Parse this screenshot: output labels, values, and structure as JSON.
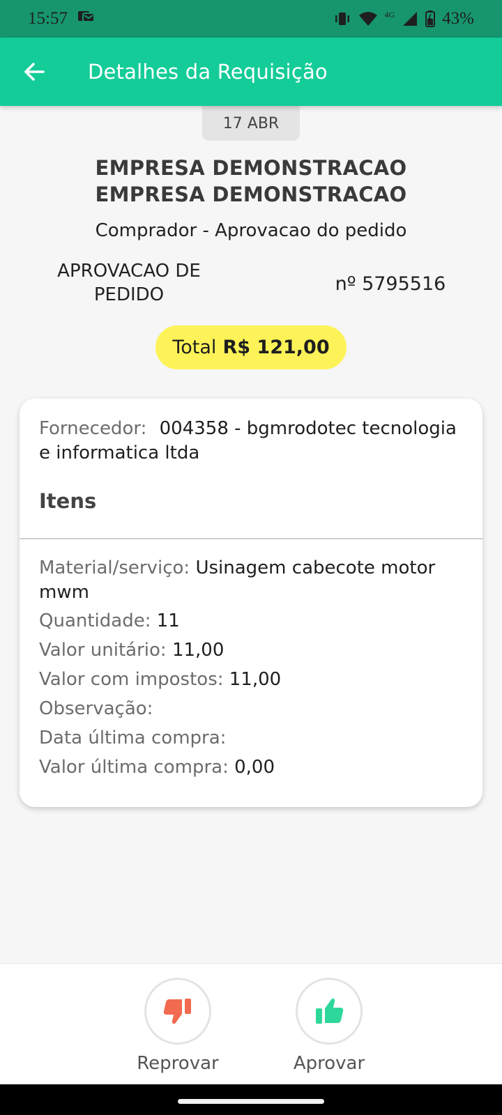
{
  "status": {
    "time": "15:57",
    "network": "4G",
    "battery": "43%"
  },
  "header": {
    "title": "Detalhes da Requisição"
  },
  "request": {
    "date": "17 ABR",
    "company_line1": "EMPRESA DEMONSTRACAO",
    "company_line2": "EMPRESA DEMONSTRACAO",
    "role": "Comprador - Aprovacao do pedido",
    "type_line1": "APROVACAO DE",
    "type_line2": "PEDIDO",
    "number": "nº 5795516",
    "total_label": "Total",
    "total_value": "R$ 121,00"
  },
  "card": {
    "supplier_label": "Fornecedor:",
    "supplier_value": "004358 - bgmrodotec tecnologia e informatica ltda",
    "items_heading": "Itens",
    "item": {
      "material_label": "Material/serviço:",
      "material_value": "Usinagem cabecote motor mwm",
      "quantity_label": "Quantidade:",
      "quantity_value": "11",
      "unit_price_label": "Valor unitário:",
      "unit_price_value": "11,00",
      "taxed_price_label": "Valor com impostos:",
      "taxed_price_value": "11,00",
      "observation_label": "Observação:",
      "observation_value": "",
      "last_purchase_date_label": "Data última compra:",
      "last_purchase_date_value": "",
      "last_purchase_value_label": "Valor última compra:",
      "last_purchase_value_value": "0,00"
    }
  },
  "actions": {
    "reject_label": "Reprovar",
    "approve_label": "Aprovar"
  },
  "colors": {
    "status_bar": "#16956f",
    "app_bar": "#14cc98",
    "total_pill": "#fdf358",
    "reject_icon": "#f26a50",
    "approve_icon": "#2ed89a"
  },
  "icons": {
    "back": "arrow-left-icon",
    "reject": "thumbs-down-icon",
    "approve": "thumbs-up-icon"
  }
}
